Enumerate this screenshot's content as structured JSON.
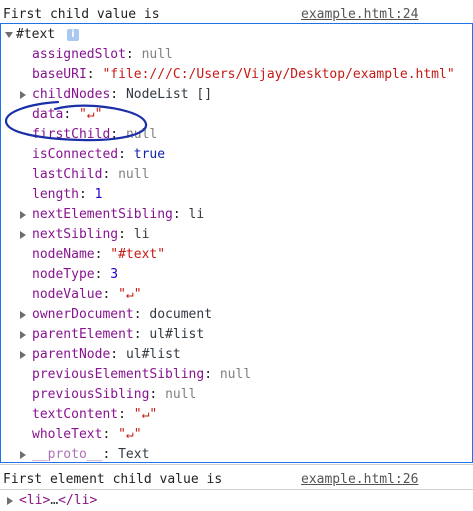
{
  "log1": {
    "message": "First child value is",
    "source": "example.html:24"
  },
  "node": {
    "header": "#text",
    "info_icon": "i",
    "props": [
      {
        "key": "assignedSlot",
        "value": "null",
        "type": "null",
        "expandable": false
      },
      {
        "key": "baseURI",
        "value": "\"file:///C:/Users/Vijay/Desktop/example.html\"",
        "type": "string",
        "expandable": false
      },
      {
        "key": "childNodes",
        "value": "NodeList []",
        "type": "object",
        "expandable": true
      },
      {
        "key": "data",
        "value": "\"↵\"",
        "type": "string",
        "expandable": false
      },
      {
        "key": "firstChild",
        "value": "null",
        "type": "null",
        "expandable": false
      },
      {
        "key": "isConnected",
        "value": "true",
        "type": "keyword",
        "expandable": false
      },
      {
        "key": "lastChild",
        "value": "null",
        "type": "null",
        "expandable": false
      },
      {
        "key": "length",
        "value": "1",
        "type": "number",
        "expandable": false
      },
      {
        "key": "nextElementSibling",
        "value": "li",
        "type": "object",
        "expandable": true
      },
      {
        "key": "nextSibling",
        "value": "li",
        "type": "object",
        "expandable": true
      },
      {
        "key": "nodeName",
        "value": "\"#text\"",
        "type": "string",
        "expandable": false
      },
      {
        "key": "nodeType",
        "value": "3",
        "type": "number",
        "expandable": false
      },
      {
        "key": "nodeValue",
        "value": "\"↵\"",
        "type": "string",
        "expandable": false
      },
      {
        "key": "ownerDocument",
        "value": "document",
        "type": "object",
        "expandable": true
      },
      {
        "key": "parentElement",
        "value": "ul#list",
        "type": "object",
        "expandable": true
      },
      {
        "key": "parentNode",
        "value": "ul#list",
        "type": "object",
        "expandable": true
      },
      {
        "key": "previousElementSibling",
        "value": "null",
        "type": "null",
        "expandable": false
      },
      {
        "key": "previousSibling",
        "value": "null",
        "type": "null",
        "expandable": false
      },
      {
        "key": "textContent",
        "value": "\"↵\"",
        "type": "string",
        "expandable": false
      },
      {
        "key": "wholeText",
        "value": "\"↵\"",
        "type": "string",
        "expandable": false
      },
      {
        "key": "__proto__",
        "value": "Text",
        "type": "object",
        "expandable": true,
        "dim": true
      }
    ]
  },
  "log2": {
    "message": "First element child value is",
    "source": "example.html:26"
  },
  "element": {
    "tag_open": "<li>",
    "ellipsis": "…",
    "tag_close": "</li>"
  },
  "annotation": {
    "color": "#1a2fa8",
    "shape": "hand-drawn circle around data property"
  }
}
